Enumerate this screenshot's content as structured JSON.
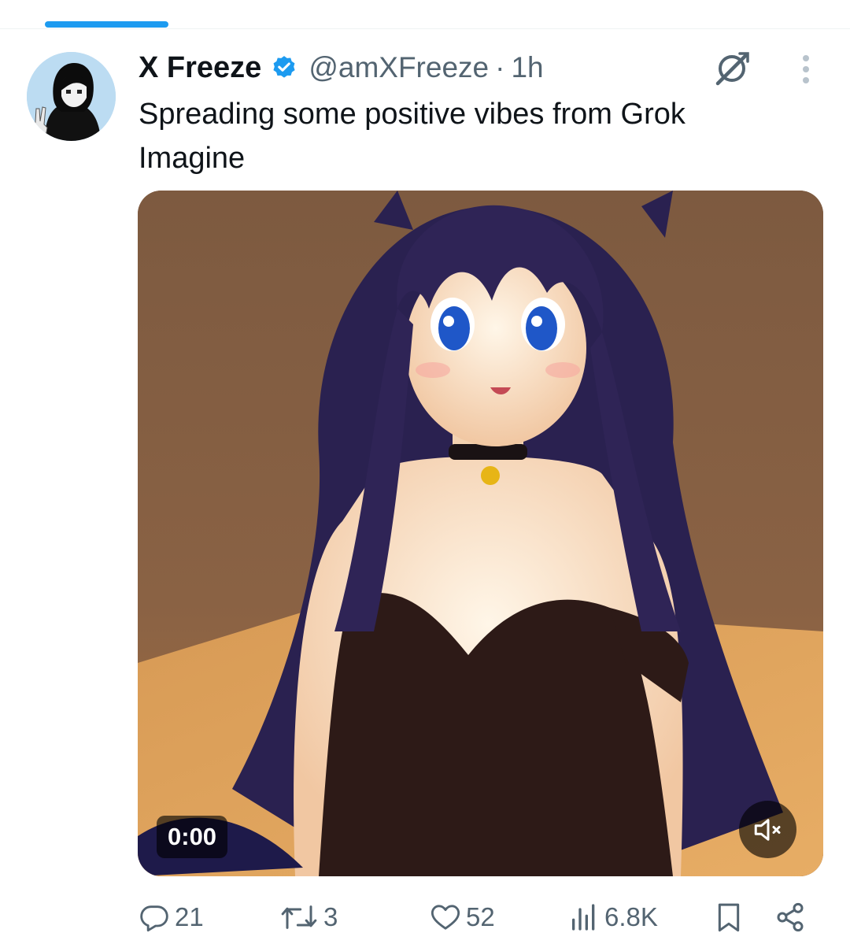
{
  "tweet": {
    "display_name": "X Freeze",
    "handle": "@amXFreeze",
    "separator": "·",
    "time": "1h",
    "text": "Spreading some positive vibes from Grok Imagine",
    "verified": true
  },
  "media": {
    "type": "video",
    "timestamp": "0:00",
    "muted": true
  },
  "actions": {
    "replies": "21",
    "reposts": "3",
    "likes": "52",
    "views": "6.8K"
  },
  "icons": {
    "verified": "verified-badge-icon",
    "grok": "grok-icon",
    "more": "more-vertical-icon",
    "reply": "reply-icon",
    "repost": "repost-icon",
    "like": "heart-icon",
    "views": "views-chart-icon",
    "bookmark": "bookmark-icon",
    "share": "share-icon",
    "mute": "speaker-muted-icon"
  },
  "colors": {
    "accent": "#1d9bf0",
    "text_primary": "#0f1419",
    "text_secondary": "#536471"
  }
}
